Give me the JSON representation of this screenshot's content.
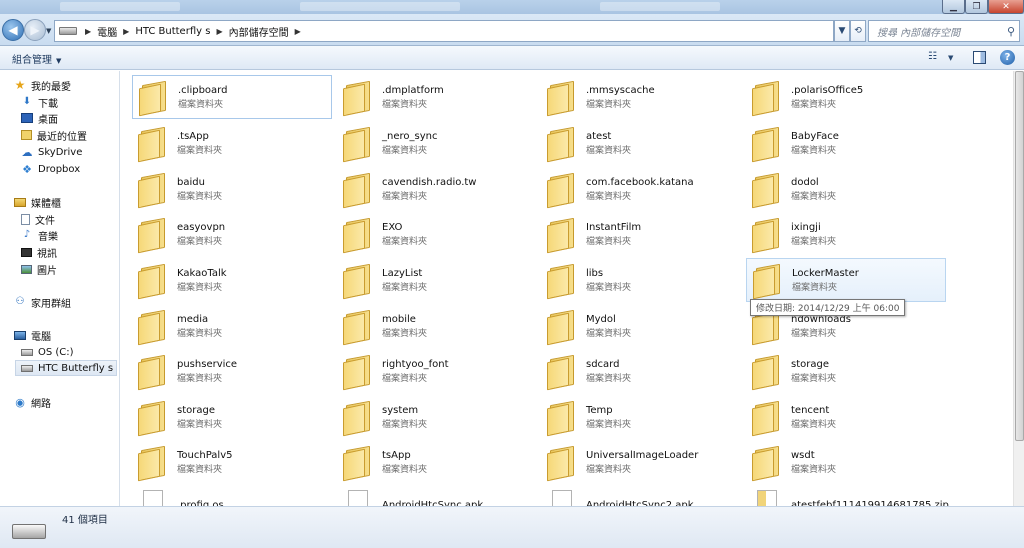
{
  "address": {
    "crumbs": [
      "電腦",
      "HTC Butterfly s",
      "內部儲存空間"
    ]
  },
  "search": {
    "placeholder": "搜尋 內部儲存空間"
  },
  "toolbar": {
    "organize_label": "組合管理"
  },
  "nav": {
    "favorites": [
      {
        "label": "我的最愛",
        "icon": "star-icon"
      },
      {
        "label": "下載",
        "icon": "download-icon"
      },
      {
        "label": "桌面",
        "icon": "desktop-icon"
      },
      {
        "label": "最近的位置",
        "icon": "recent-places-icon"
      },
      {
        "label": "SkyDrive",
        "icon": "skydrive-icon"
      },
      {
        "label": "Dropbox",
        "icon": "dropbox-icon"
      }
    ],
    "libraries": [
      {
        "label": "媒體櫃",
        "icon": "library-icon"
      },
      {
        "label": "文件",
        "icon": "documents-icon"
      },
      {
        "label": "音樂",
        "icon": "music-icon"
      },
      {
        "label": "視訊",
        "icon": "video-icon"
      },
      {
        "label": "圖片",
        "icon": "pictures-icon"
      }
    ],
    "homegroup": {
      "label": "家用群組",
      "icon": "homegroup-icon"
    },
    "computer": [
      {
        "label": "電腦",
        "icon": "computer-icon"
      },
      {
        "label": "OS (C:)",
        "icon": "drive-icon"
      },
      {
        "label": "HTC Butterfly s",
        "icon": "phone-drive-icon"
      }
    ],
    "network": {
      "label": "網路",
      "icon": "network-icon"
    }
  },
  "items": [
    {
      "name": ".clipboard",
      "type": "檔案資料夾",
      "kind": "folder"
    },
    {
      "name": ".dmplatform",
      "type": "檔案資料夾",
      "kind": "folder"
    },
    {
      "name": ".mmsyscache",
      "type": "檔案資料夾",
      "kind": "folder"
    },
    {
      "name": ".polarisOffice5",
      "type": "檔案資料夾",
      "kind": "folder"
    },
    {
      "name": ".tsApp",
      "type": "檔案資料夾",
      "kind": "folder"
    },
    {
      "name": "_nero_sync",
      "type": "檔案資料夾",
      "kind": "folder"
    },
    {
      "name": "atest",
      "type": "檔案資料夾",
      "kind": "folder"
    },
    {
      "name": "BabyFace",
      "type": "檔案資料夾",
      "kind": "folder"
    },
    {
      "name": "baidu",
      "type": "檔案資料夾",
      "kind": "folder"
    },
    {
      "name": "cavendish.radio.tw",
      "type": "檔案資料夾",
      "kind": "folder"
    },
    {
      "name": "com.facebook.katana",
      "type": "檔案資料夾",
      "kind": "folder"
    },
    {
      "name": "dodol",
      "type": "檔案資料夾",
      "kind": "folder"
    },
    {
      "name": "easyovpn",
      "type": "檔案資料夾",
      "kind": "folder"
    },
    {
      "name": "EXO",
      "type": "檔案資料夾",
      "kind": "folder"
    },
    {
      "name": "InstantFilm",
      "type": "檔案資料夾",
      "kind": "folder"
    },
    {
      "name": "ixingji",
      "type": "檔案資料夾",
      "kind": "folder"
    },
    {
      "name": "KakaoTalk",
      "type": "檔案資料夾",
      "kind": "folder"
    },
    {
      "name": "LazyList",
      "type": "檔案資料夾",
      "kind": "folder"
    },
    {
      "name": "libs",
      "type": "檔案資料夾",
      "kind": "folder"
    },
    {
      "name": "LockerMaster",
      "type": "檔案資料夾",
      "kind": "folder"
    },
    {
      "name": "media",
      "type": "檔案資料夾",
      "kind": "folder"
    },
    {
      "name": "mobile",
      "type": "檔案資料夾",
      "kind": "folder"
    },
    {
      "name": "Mydol",
      "type": "檔案資料夾",
      "kind": "folder"
    },
    {
      "name": "ndownloads",
      "type": "檔案資料夾",
      "kind": "folder"
    },
    {
      "name": "pushservice",
      "type": "檔案資料夾",
      "kind": "folder"
    },
    {
      "name": "rightyoo_font",
      "type": "檔案資料夾",
      "kind": "folder"
    },
    {
      "name": "sdcard",
      "type": "檔案資料夾",
      "kind": "folder"
    },
    {
      "name": "storage",
      "type": "檔案資料夾",
      "kind": "folder"
    },
    {
      "name": "storage",
      "type": "檔案資料夾",
      "kind": "folder"
    },
    {
      "name": "system",
      "type": "檔案資料夾",
      "kind": "folder"
    },
    {
      "name": "Temp",
      "type": "檔案資料夾",
      "kind": "folder"
    },
    {
      "name": "tencent",
      "type": "檔案資料夾",
      "kind": "folder"
    },
    {
      "name": "TouchPalv5",
      "type": "檔案資料夾",
      "kind": "folder"
    },
    {
      "name": "tsApp",
      "type": "檔案資料夾",
      "kind": "folder"
    },
    {
      "name": "UniversalImageLoader",
      "type": "檔案資料夾",
      "kind": "folder"
    },
    {
      "name": "wsdt",
      "type": "檔案資料夾",
      "kind": "folder"
    },
    {
      "name": ".profig.os",
      "type": "",
      "kind": "file"
    },
    {
      "name": "AndroidHtcSync.apk",
      "type": "",
      "kind": "file"
    },
    {
      "name": "AndroidHtcSync2.apk",
      "type": "",
      "kind": "file"
    },
    {
      "name": "atestfebf111419914681785.zip",
      "type": "",
      "kind": "zip"
    }
  ],
  "tooltip": {
    "text": "修改日期: 2014/12/29 上午 06:00"
  },
  "status": {
    "count": "41 個項目"
  }
}
